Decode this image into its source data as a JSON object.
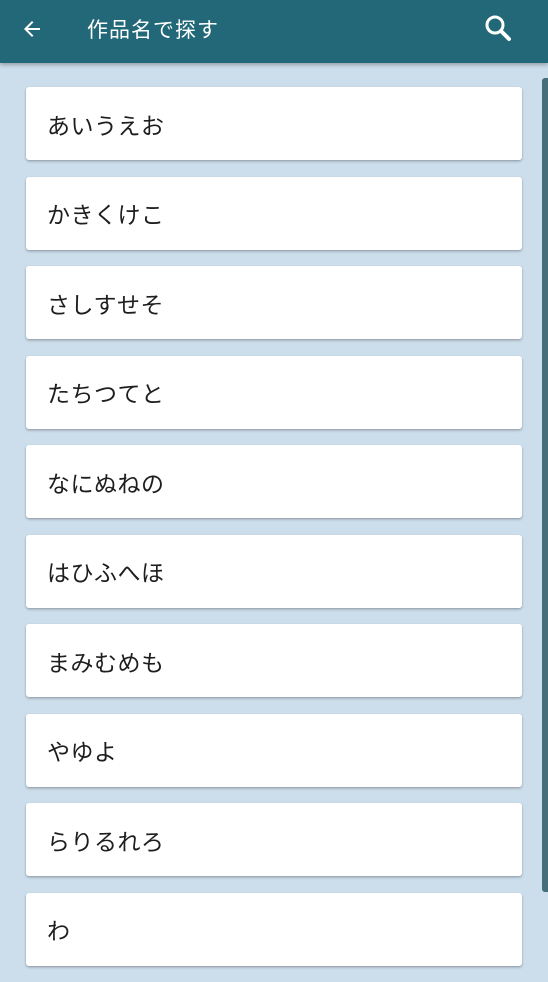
{
  "appbar": {
    "title": "作品名で探す",
    "back_icon": "arrow-left-icon",
    "search_icon": "search-icon",
    "color": "#226878"
  },
  "list": {
    "items": [
      {
        "label": "あいうえお"
      },
      {
        "label": "かきくけこ"
      },
      {
        "label": "さしすせそ"
      },
      {
        "label": "たちつてと"
      },
      {
        "label": "なにぬねの"
      },
      {
        "label": "はひふへほ"
      },
      {
        "label": "まみむめも"
      },
      {
        "label": "やゆよ"
      },
      {
        "label": "らりるれろ"
      },
      {
        "label": "わ"
      }
    ]
  },
  "colors": {
    "background": "#ccdeeb",
    "card": "#ffffff"
  }
}
